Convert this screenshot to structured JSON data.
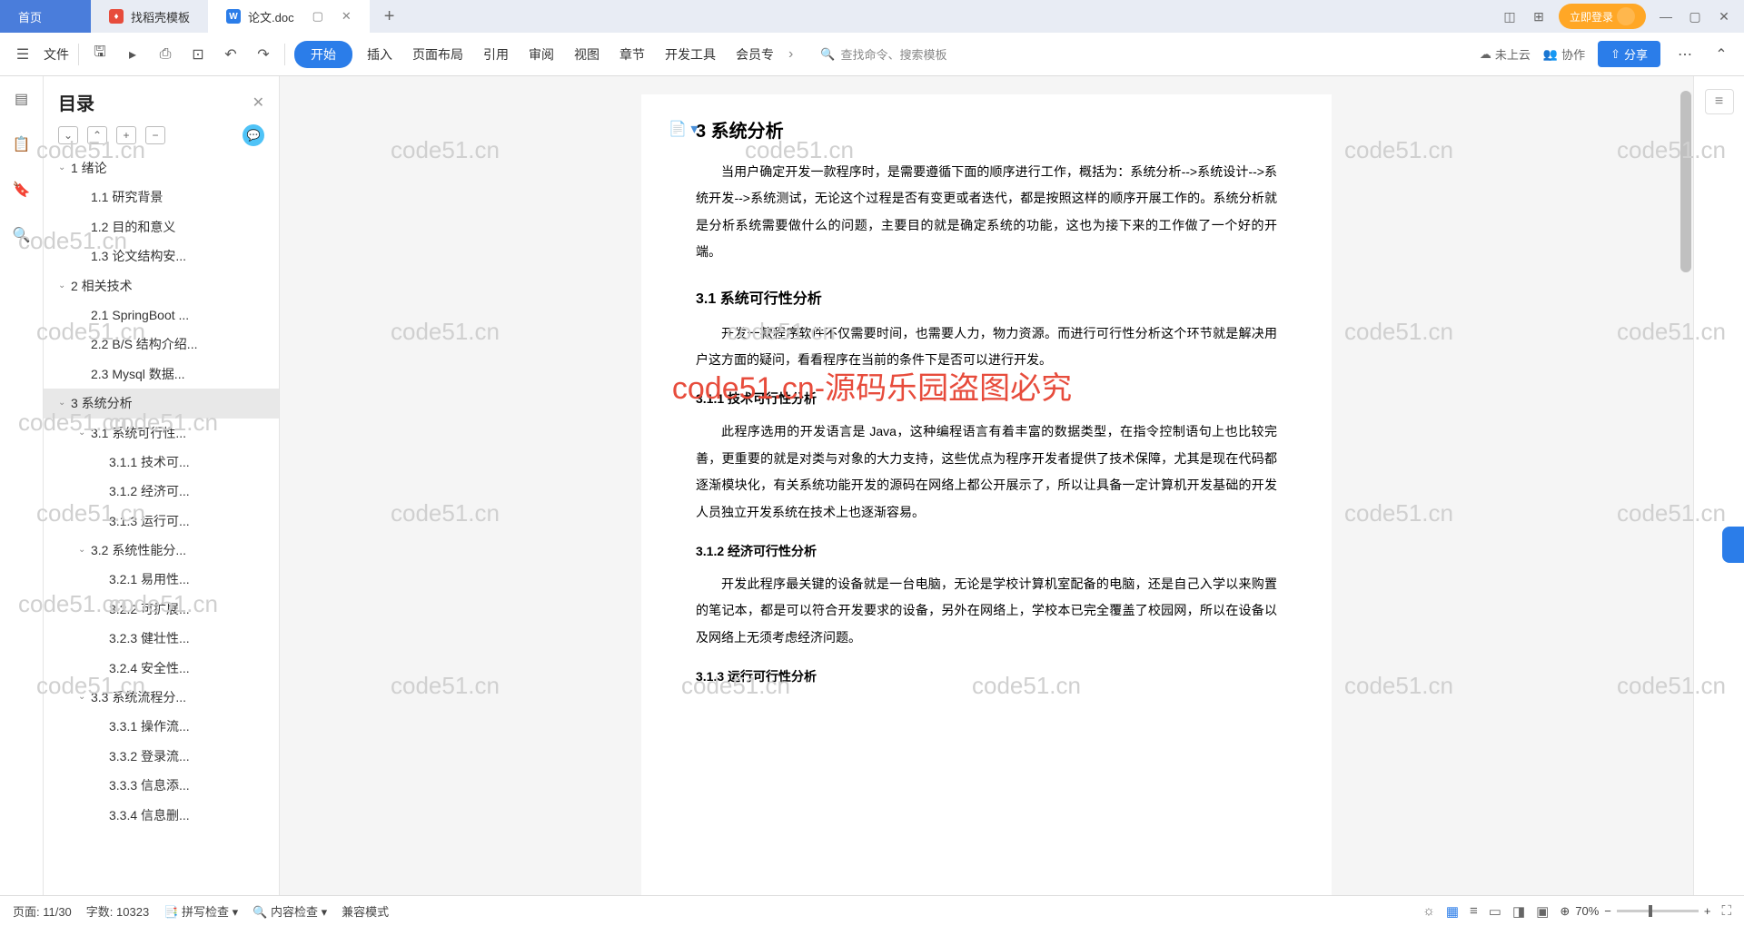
{
  "tabs": {
    "home": "首页",
    "t1": "找稻壳模板",
    "t2": "论文.doc",
    "login": "立即登录"
  },
  "ribbon": {
    "file": "文件",
    "start": "开始",
    "items": [
      "插入",
      "页面布局",
      "引用",
      "审阅",
      "视图",
      "章节",
      "开发工具",
      "会员专"
    ],
    "search": "查找命令、搜索模板",
    "cloud": "未上云",
    "coop": "协作",
    "share": "分享"
  },
  "sidebar": {
    "title": "目录",
    "toc": [
      {
        "lv": 0,
        "chev": true,
        "label": "1  绪论"
      },
      {
        "lv": 1,
        "chev": false,
        "label": "1.1  研究背景"
      },
      {
        "lv": 1,
        "chev": false,
        "label": "1.2  目的和意义"
      },
      {
        "lv": 1,
        "chev": false,
        "label": "1.3  论文结构安..."
      },
      {
        "lv": 0,
        "chev": true,
        "label": "2  相关技术"
      },
      {
        "lv": 1,
        "chev": false,
        "label": "2.1  SpringBoot ..."
      },
      {
        "lv": 1,
        "chev": false,
        "label": "2.2  B/S 结构介绍..."
      },
      {
        "lv": 1,
        "chev": false,
        "label": "2.3  Mysql 数据..."
      },
      {
        "lv": 0,
        "chev": true,
        "label": "3  系统分析",
        "sel": true
      },
      {
        "lv": 1,
        "chev": true,
        "label": "3.1  系统可行性..."
      },
      {
        "lv": 2,
        "chev": false,
        "label": "3.1.1  技术可..."
      },
      {
        "lv": 2,
        "chev": false,
        "label": "3.1.2  经济可..."
      },
      {
        "lv": 2,
        "chev": false,
        "label": "3.1.3  运行可..."
      },
      {
        "lv": 1,
        "chev": true,
        "label": "3.2  系统性能分..."
      },
      {
        "lv": 2,
        "chev": false,
        "label": "3.2.1  易用性..."
      },
      {
        "lv": 2,
        "chev": false,
        "label": "3.2.2  可扩展..."
      },
      {
        "lv": 2,
        "chev": false,
        "label": "3.2.3  健壮性..."
      },
      {
        "lv": 2,
        "chev": false,
        "label": "3.2.4  安全性..."
      },
      {
        "lv": 1,
        "chev": true,
        "label": "3.3  系统流程分..."
      },
      {
        "lv": 2,
        "chev": false,
        "label": "3.3.1  操作流..."
      },
      {
        "lv": 2,
        "chev": false,
        "label": "3.3.2  登录流..."
      },
      {
        "lv": 2,
        "chev": false,
        "label": "3.3.3  信息添..."
      },
      {
        "lv": 2,
        "chev": false,
        "label": "3.3.4  信息删..."
      }
    ]
  },
  "doc": {
    "h1": "3  系统分析",
    "p1": "当用户确定开发一款程序时，是需要遵循下面的顺序进行工作，概括为：系统分析-->系统设计-->系统开发-->系统测试，无论这个过程是否有变更或者迭代，都是按照这样的顺序开展工作的。系统分析就是分析系统需要做什么的问题，主要目的就是确定系统的功能，这也为接下来的工作做了一个好的开端。",
    "h2_1": "3.1  系统可行性分析",
    "p2": "开发一款程序软件不仅需要时间，也需要人力，物力资源。而进行可行性分析这个环节就是解决用户这方面的疑问，看看程序在当前的条件下是否可以进行开发。",
    "h3_1": "3.1.1  技术可行性分析",
    "p3": "此程序选用的开发语言是 Java，这种编程语言有着丰富的数据类型，在指令控制语句上也比较完善，更重要的就是对类与对象的大力支持，这些优点为程序开发者提供了技术保障，尤其是现在代码都逐渐模块化，有关系统功能开发的源码在网络上都公开展示了，所以让具备一定计算机开发基础的开发人员独立开发系统在技术上也逐渐容易。",
    "h3_2": "3.1.2  经济可行性分析",
    "p4": "开发此程序最关键的设备就是一台电脑，无论是学校计算机室配备的电脑，还是自己入学以来购置的笔记本，都是可以符合开发要求的设备，另外在网络上，学校本已完全覆盖了校园网，所以在设备以及网络上无须考虑经济问题。",
    "h3_3": "3.1.3  运行可行性分析"
  },
  "watermark": "code51.cn",
  "watermark_red": "code51.cn-源码乐园盗图必究",
  "status": {
    "page": "页面: 11/30",
    "words": "字数: 10323",
    "spell": "拼写检查",
    "content": "内容检查",
    "compat": "兼容模式",
    "zoom": "70%"
  }
}
